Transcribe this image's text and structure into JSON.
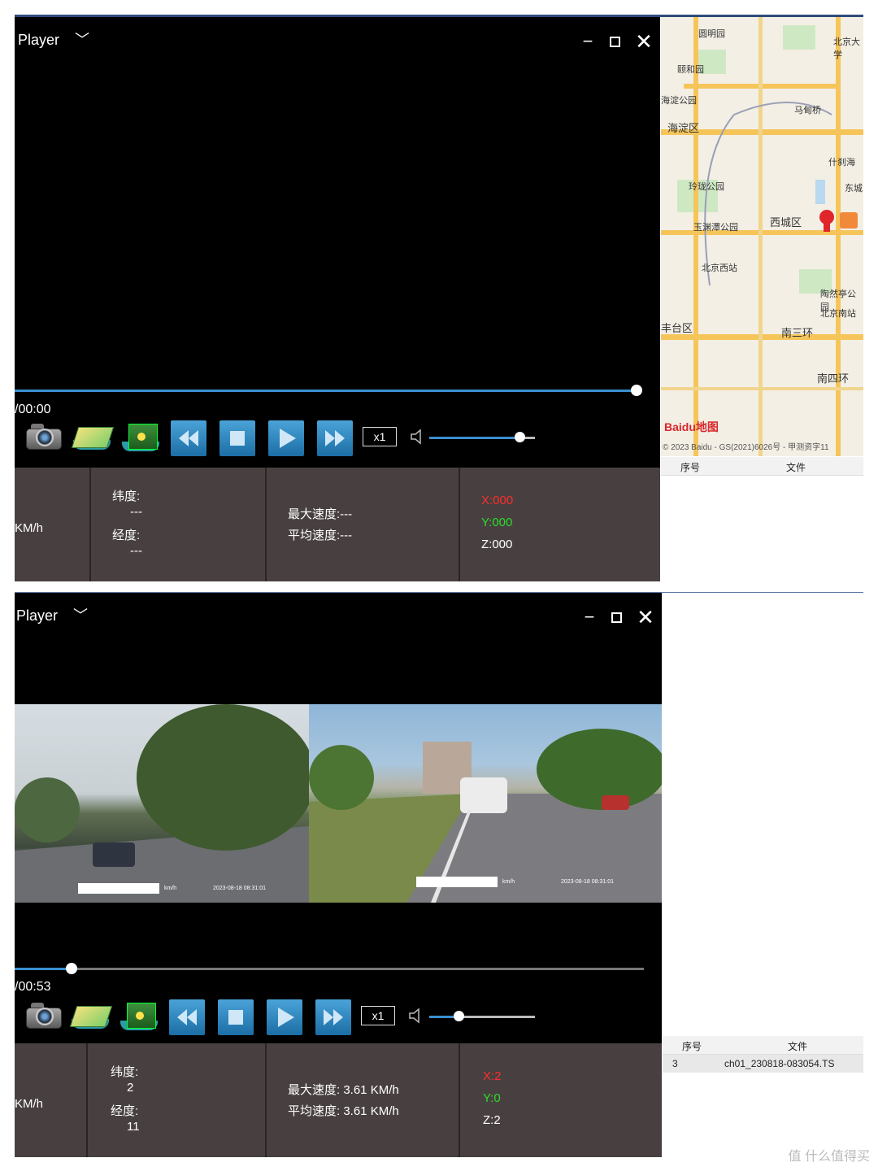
{
  "panel1": {
    "title": "Player",
    "time": "/00:00",
    "speed_btn": "x1",
    "speed_fragment": "KM/h",
    "lat_label": "纬度:",
    "lat_value": "---",
    "lon_label": "经度:",
    "lon_value": "---",
    "max_speed": "最大速度:---",
    "avg_speed": "平均速度:---",
    "axis_x": "X:000",
    "axis_y": "Y:000",
    "axis_z": "Z:000",
    "seek_progress": 1.0,
    "volume_level": 0.85,
    "map": {
      "labels": [
        "圆明园",
        "北京大学",
        "颐和园",
        "海淀公园",
        "海淀区",
        "马甸桥",
        "什刹海",
        "东城",
        "玲珑公园",
        "玉渊潭公园",
        "西城区",
        "北京西站",
        "陶然亭公园",
        "北京南站",
        "丰台区",
        "南三环",
        "南四环"
      ],
      "brand": "Baidu地图",
      "copyright": "© 2023 Baidu - GS(2021)6026号 - 甲测资字11"
    },
    "table": {
      "col_index": "序号",
      "col_file": "文件"
    }
  },
  "panel2": {
    "title": "Player",
    "time": "/00:53",
    "speed_btn": "x1",
    "speed_fragment": "KM/h",
    "lat_label": "纬度:",
    "lat_value": "2",
    "lon_label": "经度:",
    "lon_value": "11",
    "max_speed": "最大速度: 3.61 KM/h",
    "avg_speed": "平均速度: 3.61 KM/h",
    "axis_x": "X:2",
    "axis_y": "Y:0",
    "axis_z": "Z:2",
    "seek_progress": 0.09,
    "volume_level": 0.28,
    "cam1_stamp": "2023-08-18 08:31:01",
    "cam1_unit": "km/h",
    "cam2_stamp": "2023-08-18 08:31:01",
    "cam2_unit": "km/h",
    "table": {
      "col_index": "序号",
      "col_file": "文件",
      "rows": [
        {
          "index": "3",
          "file": "ch01_230818-083054.TS"
        }
      ]
    }
  },
  "watermark": "值 什么值得买",
  "colors": {
    "accent_blue": "#3a8fd0",
    "info_bg": "#484040",
    "axis_x": "#ff2d2d",
    "axis_y": "#2bdc2b"
  }
}
